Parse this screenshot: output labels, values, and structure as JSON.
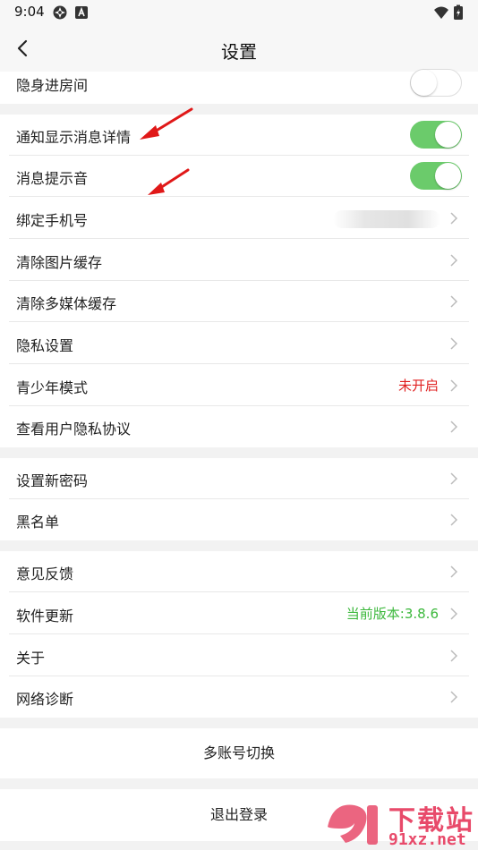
{
  "status_bar": {
    "time": "9:04",
    "icons": [
      "settings-sync-icon",
      "a-badge-icon",
      "wifi-icon",
      "battery-icon"
    ]
  },
  "header": {
    "title": "设置",
    "back_icon": "back-chevron-icon"
  },
  "privacy_group": {
    "items": [
      {
        "label": "隐身进房间",
        "type": "toggle",
        "enabled": false
      }
    ]
  },
  "main_group": {
    "items": [
      {
        "label": "通知显示消息详情",
        "type": "toggle",
        "enabled": true
      },
      {
        "label": "消息提示音",
        "type": "toggle",
        "enabled": true
      },
      {
        "label": "绑定手机号",
        "type": "link"
      },
      {
        "label": "清除图片缓存",
        "type": "link"
      },
      {
        "label": "清除多媒体缓存",
        "type": "link"
      },
      {
        "label": "隐私设置",
        "type": "link"
      },
      {
        "label": "青少年模式",
        "type": "link",
        "value": "未开启",
        "value_color": "#e02020"
      },
      {
        "label": "查看用户隐私协议",
        "type": "link"
      }
    ]
  },
  "account_group": {
    "items": [
      {
        "label": "设置新密码",
        "type": "link"
      },
      {
        "label": "黑名单",
        "type": "link"
      }
    ]
  },
  "misc_group": {
    "items": [
      {
        "label": "意见反馈",
        "type": "link"
      },
      {
        "label": "软件更新",
        "type": "link",
        "value": "当前版本:3.8.6",
        "value_color": "#3cb83c"
      },
      {
        "label": "关于",
        "type": "link"
      },
      {
        "label": "网络诊断",
        "type": "link"
      }
    ]
  },
  "buttons": {
    "switch_account": "多账号切换",
    "logout": "退出登录"
  },
  "colors": {
    "toggle_on": "#6bcb6b",
    "annotation_arrow": "#e01818"
  },
  "watermark": {
    "text_cn": "下载站",
    "text_url": "91xz.net"
  }
}
